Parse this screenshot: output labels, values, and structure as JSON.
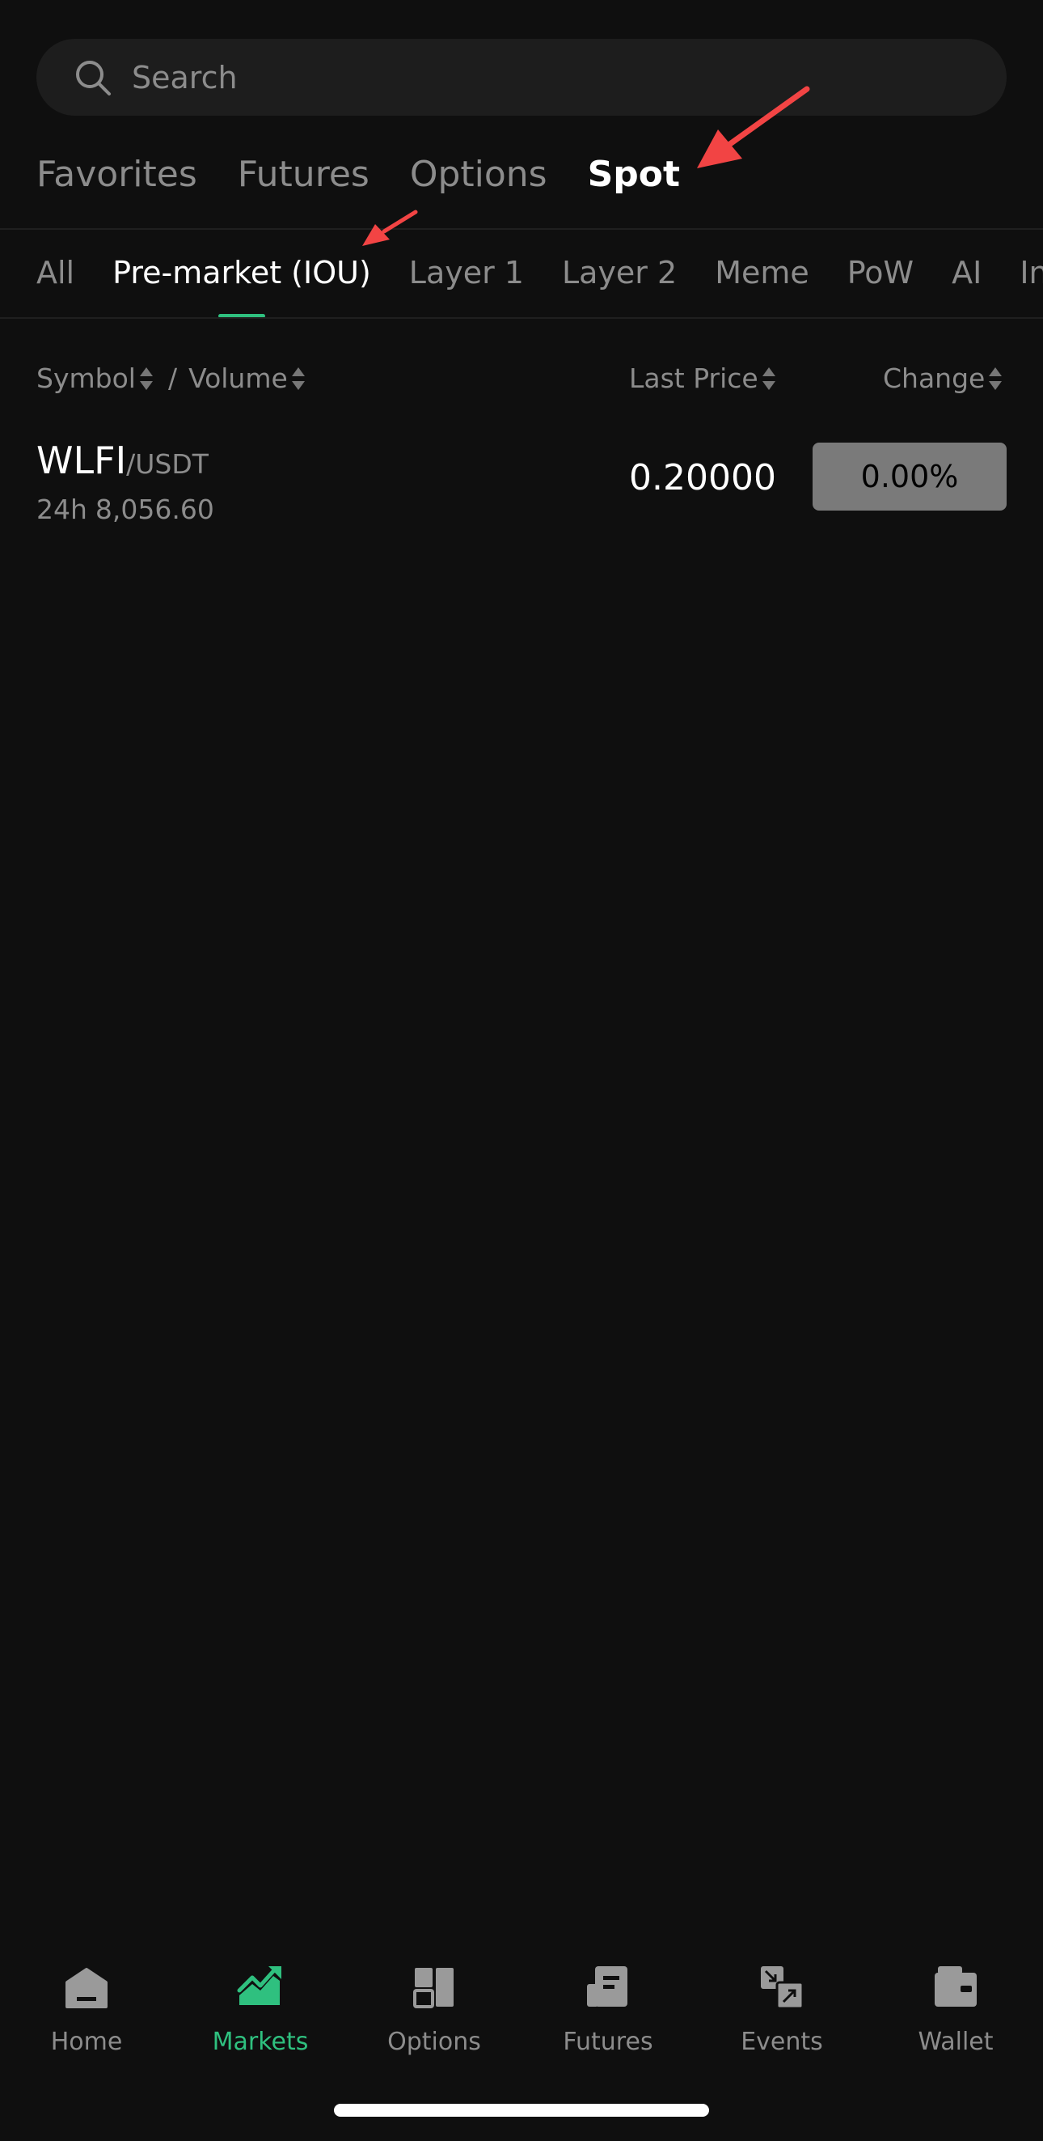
{
  "search": {
    "placeholder": "Search"
  },
  "main_tabs": [
    {
      "label": "Favorites",
      "active": false
    },
    {
      "label": "Futures",
      "active": false
    },
    {
      "label": "Options",
      "active": false
    },
    {
      "label": "Spot",
      "active": true
    }
  ],
  "category_tabs": [
    {
      "label": "All",
      "active": false
    },
    {
      "label": "Pre-market (IOU)",
      "active": true
    },
    {
      "label": "Layer 1",
      "active": false
    },
    {
      "label": "Layer 2",
      "active": false
    },
    {
      "label": "Meme",
      "active": false
    },
    {
      "label": "PoW",
      "active": false
    },
    {
      "label": "AI",
      "active": false
    },
    {
      "label": "Inf",
      "active": false
    }
  ],
  "columns": {
    "symbol": "Symbol",
    "separator": "/",
    "volume": "Volume",
    "last_price": "Last Price",
    "change": "Change"
  },
  "rows": [
    {
      "base": "WLFI",
      "quote": "/USDT",
      "volume_prefix": "24h",
      "volume": "8,056.60",
      "last_price": "0.20000",
      "change": "0.00%"
    }
  ],
  "bottom_nav": [
    {
      "label": "Home",
      "icon": "home-icon",
      "active": false
    },
    {
      "label": "Markets",
      "icon": "chart-trend-icon",
      "active": true
    },
    {
      "label": "Options",
      "icon": "options-icon",
      "active": false
    },
    {
      "label": "Futures",
      "icon": "futures-doc-icon",
      "active": false
    },
    {
      "label": "Events",
      "icon": "events-icon",
      "active": false
    },
    {
      "label": "Wallet",
      "icon": "wallet-icon",
      "active": false
    }
  ],
  "colors": {
    "background": "#0f0f0f",
    "accent": "#2fc07f",
    "muted_text": "#8c8c8c",
    "change_badge": "#7a7a7a",
    "annotation_arrow": "#f24444"
  }
}
